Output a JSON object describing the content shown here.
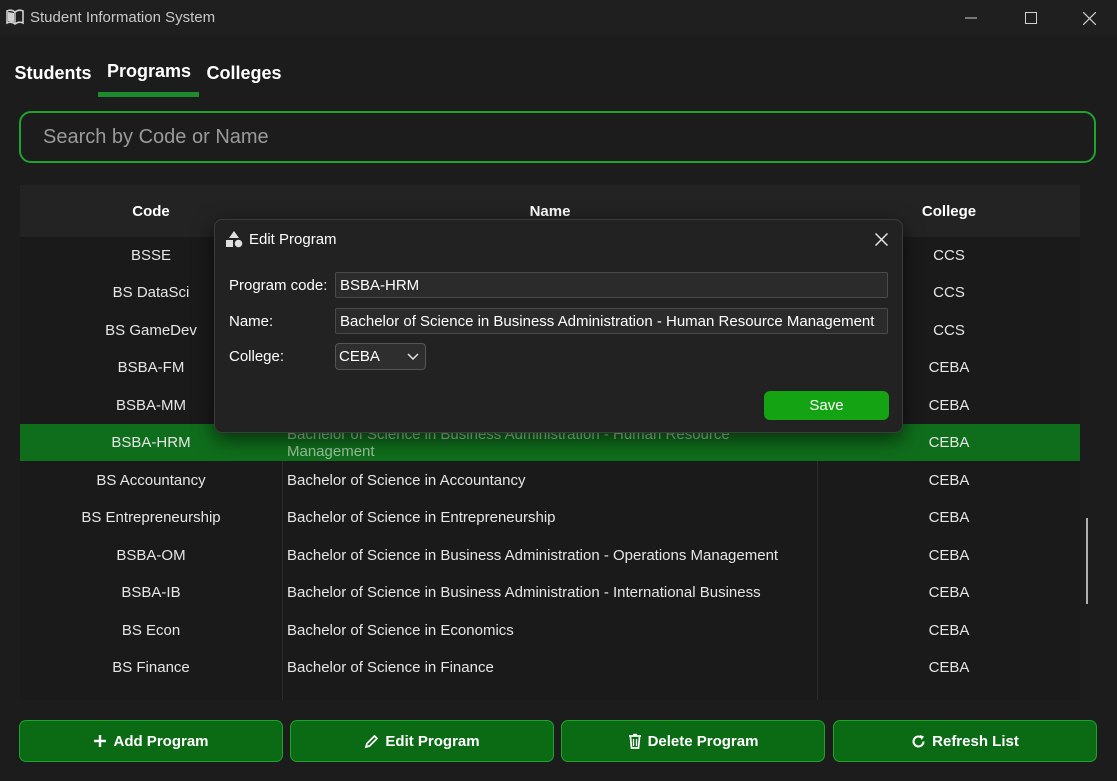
{
  "window": {
    "title": "Student Information System",
    "controls": [
      "minimize-icon",
      "maximize-icon",
      "close-icon"
    ]
  },
  "tabs": [
    {
      "label": "Students"
    },
    {
      "label": "Programs",
      "active": true
    },
    {
      "label": "Colleges"
    }
  ],
  "search": {
    "placeholder": "Search by Code or Name",
    "value": ""
  },
  "table": {
    "headers": {
      "code": "Code",
      "name": "Name",
      "college": "College"
    },
    "rows": [
      {
        "code": "BSSE",
        "name": "",
        "college": "CCS"
      },
      {
        "code": "BS DataSci",
        "name": "",
        "college": "CCS"
      },
      {
        "code": "BS GameDev",
        "name": "",
        "college": "CCS"
      },
      {
        "code": "BSBA-FM",
        "name": "",
        "college": "CEBA"
      },
      {
        "code": "BSBA-MM",
        "name": "",
        "college": "CEBA"
      },
      {
        "code": "BSBA-HRM",
        "name": "Bachelor of Science in Business Administration - Human Resource Management",
        "college": "CEBA",
        "selected": true
      },
      {
        "code": "BS Accountancy",
        "name": "Bachelor of Science in Accountancy",
        "college": "CEBA"
      },
      {
        "code": "BS Entrepreneurship",
        "name": "Bachelor of Science in Entrepreneurship",
        "college": "CEBA"
      },
      {
        "code": "BSBA-OM",
        "name": "Bachelor of Science in Business Administration - Operations Management",
        "college": "CEBA"
      },
      {
        "code": "BSBA-IB",
        "name": "Bachelor of Science in Business Administration - International Business",
        "college": "CEBA"
      },
      {
        "code": "BS Econ",
        "name": "Bachelor of Science in Economics",
        "college": "CEBA"
      },
      {
        "code": "BS Finance",
        "name": "Bachelor of Science in Finance",
        "college": "CEBA"
      }
    ]
  },
  "actions": {
    "add": {
      "label": "Add Program",
      "icon": "plus-icon"
    },
    "edit": {
      "label": "Edit Program",
      "icon": "pencil-icon"
    },
    "delete": {
      "label": "Delete Program",
      "icon": "trash-icon"
    },
    "refresh": {
      "label": "Refresh List",
      "icon": "refresh-icon"
    }
  },
  "dialog": {
    "title": "Edit Program",
    "code_label": "Program code:",
    "code_value": "BSBA-HRM",
    "name_label": "Name:",
    "name_value": "Bachelor of Science in Business Administration - Human Resource Management",
    "college_label": "College:",
    "college_value": "CEBA",
    "save_label": "Save"
  },
  "colors": {
    "accent": "#1d8a2e",
    "selected_row": "#0f6e1c",
    "button_bg": "#0b6b14",
    "save_bg": "#13a313"
  }
}
